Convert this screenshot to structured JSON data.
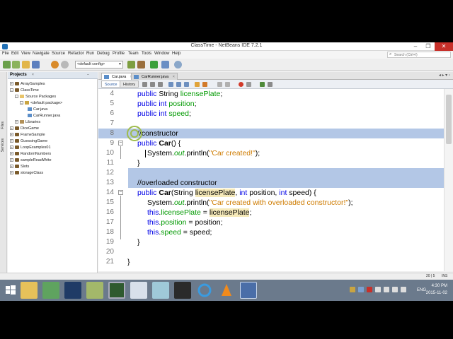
{
  "window": {
    "title": "ClassTime - NetBeans IDE 7.2.1"
  },
  "menu": [
    "File",
    "Edit",
    "View",
    "Navigate",
    "Source",
    "Refactor",
    "Run",
    "Debug",
    "Profile",
    "Team",
    "Tools",
    "Window",
    "Help"
  ],
  "search": {
    "placeholder": "Search (Ctrl+I)"
  },
  "toolbar": {
    "config_value": "<default config>"
  },
  "side_tabs": [
    "Files",
    "Services"
  ],
  "projects_panel": {
    "title": "Projects",
    "tree": [
      {
        "label": "ArraySamples",
        "icon": "project-icon"
      },
      {
        "label": "ClassTime",
        "icon": "project-icon"
      },
      {
        "label": "Source Packages",
        "icon": "source-packages-icon"
      },
      {
        "label": "<default package>",
        "icon": "package-icon"
      },
      {
        "label": "Car.java",
        "icon": "java-file-icon"
      },
      {
        "label": "CarRunner.java",
        "icon": "java-file-icon"
      },
      {
        "label": "Libraries",
        "icon": "libraries-icon"
      },
      {
        "label": "DiceGame",
        "icon": "project-icon"
      },
      {
        "label": "FrameSample",
        "icon": "project-icon"
      },
      {
        "label": "GuessingGame",
        "icon": "project-icon"
      },
      {
        "label": "LoopExamples01",
        "icon": "project-icon"
      },
      {
        "label": "RandomNumbers",
        "icon": "project-icon"
      },
      {
        "label": "sampleReadWrite",
        "icon": "project-icon"
      },
      {
        "label": "Slots",
        "icon": "project-icon"
      },
      {
        "label": "storageClass",
        "icon": "project-icon"
      }
    ]
  },
  "editor": {
    "tabs": [
      {
        "label": "Car.java",
        "close": "×"
      },
      {
        "label": "CarRunner.java",
        "close": "×"
      }
    ],
    "views": {
      "source": "Source",
      "history": "History"
    },
    "lines": {
      "l4": "4",
      "l5": "5",
      "l6": "6",
      "l7": "7",
      "l8": "8",
      "l9": "9",
      "l10": "10",
      "l11": "11",
      "l12": "12",
      "l13": "13",
      "l14": "14",
      "l15": "15",
      "l16": "16",
      "l17": "17",
      "l18": "18",
      "l19": "19",
      "l20": "20",
      "l21": "21"
    },
    "code": {
      "public": "public",
      "int": "int",
      "this": "this",
      "String": "String",
      "Car": "Car",
      "System": "System.",
      "out": "out",
      "println": ".println(",
      "licensePlate": "licensePlate",
      "position": "position",
      "speed": "speed",
      "comment_constructor": "//constructor",
      "comment_overloaded": "//overloaded constructor",
      "str_created": "\"Car created!\"",
      "str_overloaded": "\"Car created with overloaded constructor!\""
    }
  },
  "status": {
    "position": "20 | 5",
    "mode": "INS"
  },
  "taskbar": {
    "time": "4:30 PM",
    "date": "2015-11-02",
    "language": "ENG"
  },
  "colors": {
    "keyword": "#0000e6",
    "comment": "#969696",
    "string": "#ce7b00",
    "field": "#009900",
    "selection": "#b3c7e6",
    "taskbar": "#6b7a8c"
  }
}
